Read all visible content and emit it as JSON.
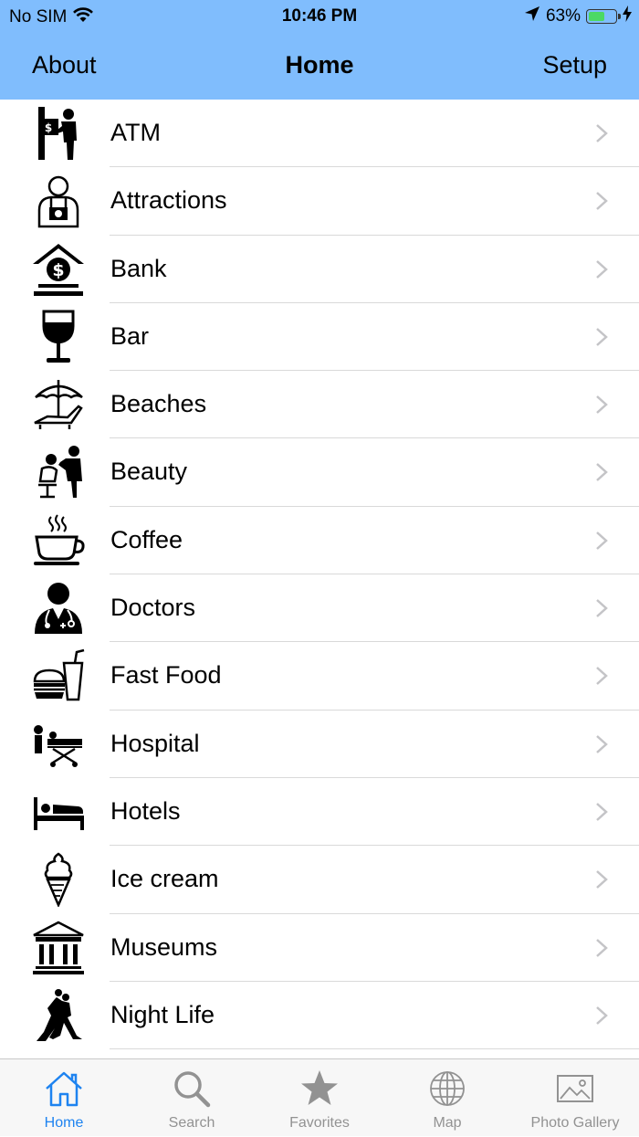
{
  "status_bar": {
    "carrier": "No SIM",
    "time": "10:46 PM",
    "battery_percent": "63%",
    "battery_level": 0.63,
    "battery_color": "#4cd964"
  },
  "nav": {
    "left_label": "About",
    "title": "Home",
    "right_label": "Setup",
    "background": "#80bdfd"
  },
  "categories": [
    {
      "label": "ATM",
      "icon": "atm-icon"
    },
    {
      "label": "Attractions",
      "icon": "photographer-icon"
    },
    {
      "label": "Bank",
      "icon": "bank-icon"
    },
    {
      "label": "Bar",
      "icon": "wine-glass-icon"
    },
    {
      "label": "Beaches",
      "icon": "beach-umbrella-icon"
    },
    {
      "label": "Beauty",
      "icon": "hairdresser-icon"
    },
    {
      "label": "Coffee",
      "icon": "coffee-cup-icon"
    },
    {
      "label": "Doctors",
      "icon": "doctor-icon"
    },
    {
      "label": "Fast Food",
      "icon": "burger-drink-icon"
    },
    {
      "label": "Hospital",
      "icon": "hospital-bed-icon"
    },
    {
      "label": "Hotels",
      "icon": "bed-icon"
    },
    {
      "label": "Ice cream",
      "icon": "ice-cream-icon"
    },
    {
      "label": "Museums",
      "icon": "museum-icon"
    },
    {
      "label": "Night Life",
      "icon": "dancers-icon"
    }
  ],
  "tab_bar": {
    "active_color": "#1e83f0",
    "inactive_color": "#929292",
    "tabs": [
      {
        "label": "Home",
        "icon": "home-icon",
        "active": true
      },
      {
        "label": "Search",
        "icon": "search-icon",
        "active": false
      },
      {
        "label": "Favorites",
        "icon": "star-icon",
        "active": false
      },
      {
        "label": "Map",
        "icon": "globe-icon",
        "active": false
      },
      {
        "label": "Photo Gallery",
        "icon": "photo-icon",
        "active": false
      }
    ]
  }
}
